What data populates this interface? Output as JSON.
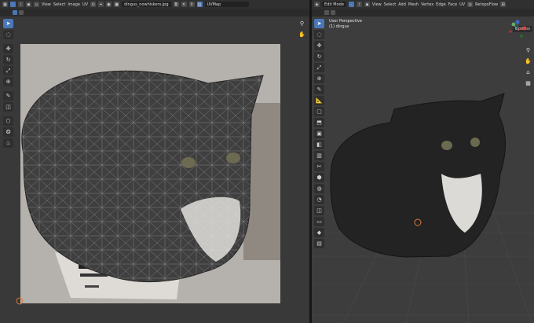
{
  "uv_editor": {
    "menus": [
      "View",
      "Select",
      "Image",
      "UV"
    ],
    "image_name": "dingus_nowhiskers.jpg",
    "uvmap": "UVMap"
  },
  "viewport": {
    "mode": "Edit Mode",
    "menus": [
      "View",
      "Select",
      "Add",
      "Mesh",
      "Vertex",
      "Edge",
      "Face",
      "UV"
    ],
    "retopoflow": "RetopoFlow",
    "perspective": "User Perspective",
    "object": "(1) dingus",
    "options": "Options"
  },
  "colors": {
    "header": "#303030",
    "accent": "#4a77b8",
    "uv_bg": "#393939",
    "viewport_bg": "#3d3d3d"
  },
  "icons": {
    "uv_tools": [
      "cursor-icon",
      "select-icon",
      "move-icon",
      "rotate-icon",
      "scale-icon",
      "transform-icon",
      "annotate-icon",
      "rip-icon",
      "grab-icon",
      "relax-icon",
      "pinch-icon"
    ],
    "vp_tools": [
      "cursor-icon",
      "select-icon",
      "move-icon",
      "rotate-icon",
      "scale-icon",
      "transform-icon",
      "annotate-icon",
      "measure-icon",
      "add-cube-icon",
      "extrude-icon",
      "inset-icon",
      "bevel-icon",
      "loop-cut-icon",
      "knife-icon",
      "poly-build-icon",
      "spin-icon",
      "smooth-icon",
      "edge-slide-icon",
      "shrink-icon",
      "shear-icon",
      "rip-region-icon"
    ]
  }
}
